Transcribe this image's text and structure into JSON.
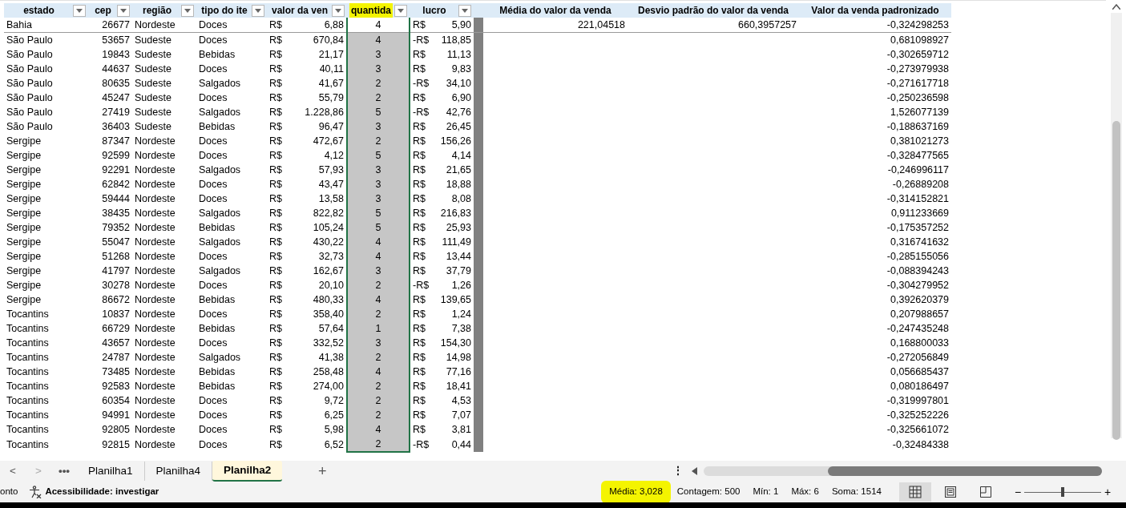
{
  "columns": [
    {
      "label": "estado",
      "kind": "text",
      "filter": true,
      "selected": false,
      "highlighted": false
    },
    {
      "label": "cep",
      "kind": "number",
      "filter": true,
      "selected": false,
      "highlighted": false
    },
    {
      "label": "região",
      "kind": "text",
      "filter": true,
      "selected": false,
      "highlighted": false
    },
    {
      "label": "tipo do ite",
      "kind": "text",
      "filter": true,
      "selected": false,
      "highlighted": false
    },
    {
      "label": "valor da ven",
      "kind": "currency",
      "filter": true,
      "selected": false,
      "highlighted": false
    },
    {
      "label": "quantida",
      "kind": "count",
      "filter": true,
      "selected": true,
      "highlighted": true
    },
    {
      "label": "lucro",
      "kind": "currency",
      "filter": true,
      "selected": false,
      "highlighted": false
    },
    {
      "label": "Média do valor da venda",
      "kind": "number",
      "filter": false,
      "selected": false,
      "highlighted": false
    },
    {
      "label": "Desvio padrão do valor da venda",
      "kind": "number",
      "filter": false,
      "selected": false,
      "highlighted": false
    },
    {
      "label": "Valor da venda padronizado",
      "kind": "number",
      "filter": false,
      "selected": false,
      "highlighted": false
    }
  ],
  "rows": [
    [
      "Bahia",
      "26677",
      "Nordeste",
      "Doces",
      [
        "R$",
        "6,88"
      ],
      "4",
      [
        "R$",
        "5,90"
      ],
      "221,04518",
      "660,3957257",
      "-0,324298253"
    ],
    [
      "São Paulo",
      "53657",
      "Sudeste",
      "Doces",
      [
        "R$",
        "670,84"
      ],
      "4",
      [
        "-R$",
        "118,85"
      ],
      null,
      null,
      "0,681098927"
    ],
    [
      "São Paulo",
      "19843",
      "Sudeste",
      "Bebidas",
      [
        "R$",
        "21,17"
      ],
      "3",
      [
        "R$",
        "11,13"
      ],
      null,
      null,
      "-0,302659712"
    ],
    [
      "São Paulo",
      "44637",
      "Sudeste",
      "Doces",
      [
        "R$",
        "40,11"
      ],
      "3",
      [
        "R$",
        "9,83"
      ],
      null,
      null,
      "-0,273979938"
    ],
    [
      "São Paulo",
      "80635",
      "Sudeste",
      "Salgados",
      [
        "R$",
        "41,67"
      ],
      "2",
      [
        "-R$",
        "34,10"
      ],
      null,
      null,
      "-0,271617718"
    ],
    [
      "São Paulo",
      "45247",
      "Sudeste",
      "Doces",
      [
        "R$",
        "55,79"
      ],
      "2",
      [
        "R$",
        "6,90"
      ],
      null,
      null,
      "-0,250236598"
    ],
    [
      "São Paulo",
      "27419",
      "Sudeste",
      "Salgados",
      [
        "R$",
        "1.228,86"
      ],
      "5",
      [
        "-R$",
        "42,76"
      ],
      null,
      null,
      "1,526077139"
    ],
    [
      "São Paulo",
      "36403",
      "Sudeste",
      "Bebidas",
      [
        "R$",
        "96,47"
      ],
      "3",
      [
        "R$",
        "26,45"
      ],
      null,
      null,
      "-0,188637169"
    ],
    [
      "Sergipe",
      "87347",
      "Nordeste",
      "Doces",
      [
        "R$",
        "472,67"
      ],
      "2",
      [
        "R$",
        "156,26"
      ],
      null,
      null,
      "0,381021273"
    ],
    [
      "Sergipe",
      "92599",
      "Nordeste",
      "Doces",
      [
        "R$",
        "4,12"
      ],
      "5",
      [
        "R$",
        "4,14"
      ],
      null,
      null,
      "-0,328477565"
    ],
    [
      "Sergipe",
      "92291",
      "Nordeste",
      "Salgados",
      [
        "R$",
        "57,93"
      ],
      "3",
      [
        "R$",
        "21,65"
      ],
      null,
      null,
      "-0,246996117"
    ],
    [
      "Sergipe",
      "62842",
      "Nordeste",
      "Doces",
      [
        "R$",
        "43,47"
      ],
      "3",
      [
        "R$",
        "18,88"
      ],
      null,
      null,
      "-0,26889208"
    ],
    [
      "Sergipe",
      "59444",
      "Nordeste",
      "Doces",
      [
        "R$",
        "13,58"
      ],
      "3",
      [
        "R$",
        "8,08"
      ],
      null,
      null,
      "-0,314152821"
    ],
    [
      "Sergipe",
      "38435",
      "Nordeste",
      "Salgados",
      [
        "R$",
        "822,82"
      ],
      "5",
      [
        "R$",
        "216,83"
      ],
      null,
      null,
      "0,911233669"
    ],
    [
      "Sergipe",
      "79352",
      "Nordeste",
      "Bebidas",
      [
        "R$",
        "105,24"
      ],
      "5",
      [
        "R$",
        "25,93"
      ],
      null,
      null,
      "-0,175357252"
    ],
    [
      "Sergipe",
      "55047",
      "Nordeste",
      "Salgados",
      [
        "R$",
        "430,22"
      ],
      "4",
      [
        "R$",
        "111,49"
      ],
      null,
      null,
      "0,316741632"
    ],
    [
      "Sergipe",
      "51268",
      "Nordeste",
      "Doces",
      [
        "R$",
        "32,73"
      ],
      "4",
      [
        "R$",
        "13,44"
      ],
      null,
      null,
      "-0,285155056"
    ],
    [
      "Sergipe",
      "41797",
      "Nordeste",
      "Salgados",
      [
        "R$",
        "162,67"
      ],
      "3",
      [
        "R$",
        "37,79"
      ],
      null,
      null,
      "-0,088394243"
    ],
    [
      "Sergipe",
      "30278",
      "Nordeste",
      "Doces",
      [
        "R$",
        "20,10"
      ],
      "2",
      [
        "-R$",
        "1,26"
      ],
      null,
      null,
      "-0,304279952"
    ],
    [
      "Sergipe",
      "86672",
      "Nordeste",
      "Bebidas",
      [
        "R$",
        "480,33"
      ],
      "4",
      [
        "R$",
        "139,65"
      ],
      null,
      null,
      "0,392620379"
    ],
    [
      "Tocantins",
      "10837",
      "Nordeste",
      "Doces",
      [
        "R$",
        "358,40"
      ],
      "2",
      [
        "R$",
        "1,24"
      ],
      null,
      null,
      "0,207988657"
    ],
    [
      "Tocantins",
      "66729",
      "Nordeste",
      "Bebidas",
      [
        "R$",
        "57,64"
      ],
      "1",
      [
        "R$",
        "7,38"
      ],
      null,
      null,
      "-0,247435248"
    ],
    [
      "Tocantins",
      "43657",
      "Nordeste",
      "Doces",
      [
        "R$",
        "332,52"
      ],
      "3",
      [
        "R$",
        "154,30"
      ],
      null,
      null,
      "0,168800033"
    ],
    [
      "Tocantins",
      "24787",
      "Nordeste",
      "Salgados",
      [
        "R$",
        "41,38"
      ],
      "2",
      [
        "R$",
        "14,98"
      ],
      null,
      null,
      "-0,272056849"
    ],
    [
      "Tocantins",
      "73485",
      "Nordeste",
      "Bebidas",
      [
        "R$",
        "258,48"
      ],
      "4",
      [
        "R$",
        "77,16"
      ],
      null,
      null,
      "0,056685437"
    ],
    [
      "Tocantins",
      "92583",
      "Nordeste",
      "Bebidas",
      [
        "R$",
        "274,00"
      ],
      "2",
      [
        "R$",
        "18,41"
      ],
      null,
      null,
      "0,080186497"
    ],
    [
      "Tocantins",
      "60354",
      "Nordeste",
      "Doces",
      [
        "R$",
        "9,72"
      ],
      "2",
      [
        "R$",
        "4,53"
      ],
      null,
      null,
      "-0,319997801"
    ],
    [
      "Tocantins",
      "94991",
      "Nordeste",
      "Doces",
      [
        "R$",
        "6,25"
      ],
      "2",
      [
        "R$",
        "7,07"
      ],
      null,
      null,
      "-0,325252226"
    ],
    [
      "Tocantins",
      "92805",
      "Nordeste",
      "Doces",
      [
        "R$",
        "5,98"
      ],
      "4",
      [
        "R$",
        "3,81"
      ],
      null,
      null,
      "-0,325661072"
    ],
    [
      "Tocantins",
      "92815",
      "Nordeste",
      "Doces",
      [
        "R$",
        "6,52"
      ],
      "2",
      [
        "-R$",
        "0,44"
      ],
      null,
      null,
      "-0,32484338"
    ]
  ],
  "sheet_tabs": {
    "nav": [
      "<",
      ">",
      "•••"
    ],
    "tabs": [
      {
        "label": "Planilha1",
        "selected": false
      },
      {
        "label": "Planilha4",
        "selected": false
      },
      {
        "label": "Planilha2",
        "selected": true
      }
    ],
    "add": "+",
    "more": "⋮"
  },
  "status_bar": {
    "mode": "onto",
    "accessibility": "Acessibilidade: investigar",
    "stats": [
      {
        "text": "Média: 3,028",
        "highlighted": true
      },
      {
        "text": "Contagem: 500",
        "highlighted": false
      },
      {
        "text": "Mín: 1",
        "highlighted": false
      },
      {
        "text": "Máx: 6",
        "highlighted": false
      },
      {
        "text": "Soma: 1514",
        "highlighted": false
      }
    ],
    "views": [
      {
        "kind": "normal",
        "selected": true
      },
      {
        "kind": "page_layout",
        "selected": false
      },
      {
        "kind": "page_break",
        "selected": false
      }
    ],
    "zoom": {
      "minus": "−",
      "plus": "+",
      "level": 0.5
    }
  }
}
